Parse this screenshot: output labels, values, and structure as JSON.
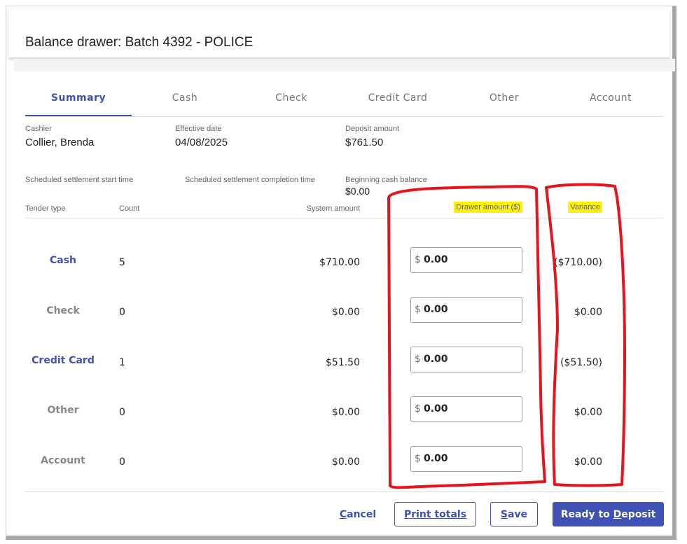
{
  "dialog": {
    "title": "Balance drawer: Batch 4392 - POLICE"
  },
  "tabs": [
    {
      "label": "Summary",
      "active": true
    },
    {
      "label": "Cash",
      "active": false
    },
    {
      "label": "Check",
      "active": false
    },
    {
      "label": "Credit Card",
      "active": false
    },
    {
      "label": "Other",
      "active": false
    },
    {
      "label": "Account",
      "active": false
    }
  ],
  "info": {
    "cashier_label": "Cashier",
    "cashier_value": "Collier, Brenda",
    "effective_date_label": "Effective date",
    "effective_date_value": "04/08/2025",
    "deposit_amount_label": "Deposit amount",
    "deposit_amount_value": "$761.50",
    "settlement_start_label": "Scheduled settlement start time",
    "settlement_completion_label": "Scheduled settlement completion time",
    "beginning_cash_label": "Beginning cash balance",
    "beginning_cash_value": "$0.00"
  },
  "table": {
    "headers": {
      "tender_type": "Tender type",
      "count": "Count",
      "system_amount": "System amount",
      "drawer_amount": "Drawer amount ($)",
      "variance": "Variance"
    },
    "currency_prefix": "$",
    "rows": [
      {
        "tender": "Cash",
        "count": "5",
        "system_amount": "$710.00",
        "drawer_amount": "0.00",
        "variance": "($710.00)"
      },
      {
        "tender": "Check",
        "count": "0",
        "system_amount": "$0.00",
        "drawer_amount": "0.00",
        "variance": "$0.00"
      },
      {
        "tender": "Credit Card",
        "count": "1",
        "system_amount": "$51.50",
        "drawer_amount": "0.00",
        "variance": "($51.50)"
      },
      {
        "tender": "Other",
        "count": "0",
        "system_amount": "$0.00",
        "drawer_amount": "0.00",
        "variance": "$0.00"
      },
      {
        "tender": "Account",
        "count": "0",
        "system_amount": "$0.00",
        "drawer_amount": "0.00",
        "variance": "$0.00"
      }
    ]
  },
  "footer": {
    "cancel_prefix": "",
    "cancel_underline": "C",
    "cancel_rest": "ancel",
    "print_underline": "P",
    "print_rest": "rint totals",
    "save_underline": "S",
    "save_rest": "ave",
    "ready_prefix": "Ready to ",
    "ready_underline": "D",
    "ready_rest": "eposit"
  },
  "colors": {
    "accent": "#3f51b5",
    "highlight": "#fff200",
    "annotation": "#e8141b"
  }
}
